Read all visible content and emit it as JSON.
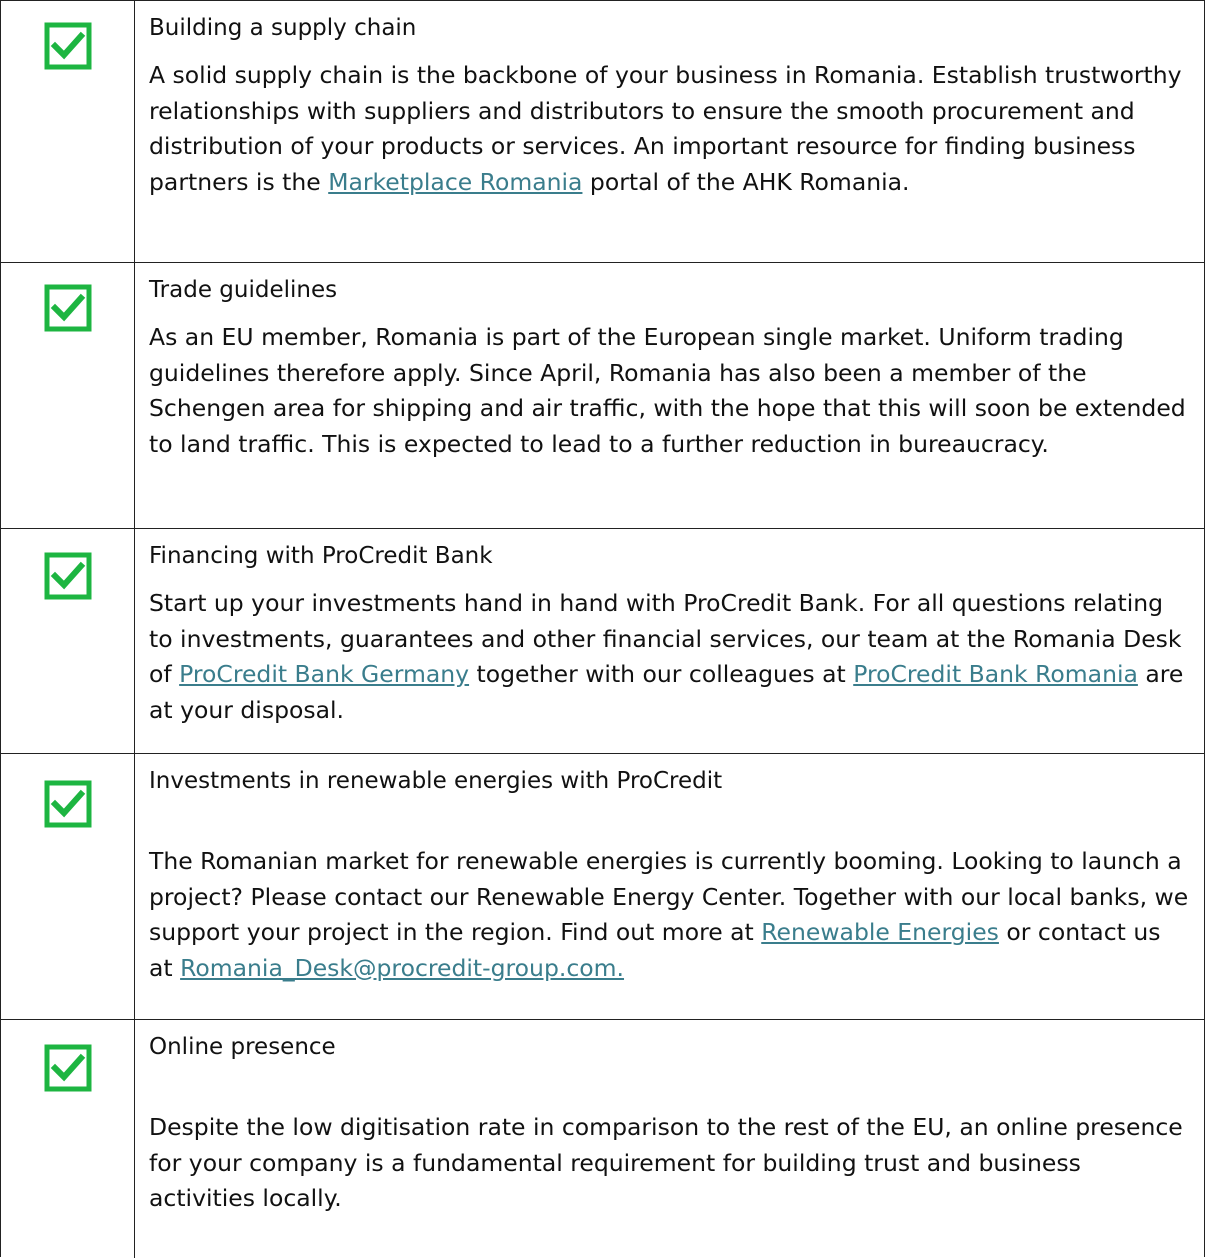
{
  "icon_color": "#1db541",
  "link_color": "#3a7d8c",
  "items": [
    {
      "icon": "checked-box-icon",
      "title": "Building a supply chain",
      "body_a": "A solid supply chain is the backbone of your business in Romania. Establish trustworthy relationships with suppliers and distributors to ensure the smooth procurement and distribution of your products or services. An important resource for finding business partners is the ",
      "link_1": "Marketplace Romania",
      "body_b": " portal of the AHK Romania."
    },
    {
      "icon": "checked-box-icon",
      "title": "Trade guidelines",
      "body_a": "As an EU member, Romania is part of the European single market. Uniform trading guidelines therefore apply. Since April, Romania has also been a member of the Schengen area for shipping and air traffic, with the hope that this will soon be extended to land traffic. This is expected to lead to a further reduction in bureaucracy."
    },
    {
      "icon": "checked-box-icon",
      "title": "Financing with ProCredit Bank",
      "body_a": "Start up your investments hand in hand with ProCredit Bank. For all questions relating to investments, guarantees and other financial services, our team at the Romania Desk of ",
      "link_1": "ProCredit Bank Germany",
      "body_b": " together with our colleagues at ",
      "link_2": "ProCredit Bank Romania",
      "body_c": " are at your disposal."
    },
    {
      "icon": "checked-box-icon",
      "title": "Investments in renewable energies with ProCredit",
      "body_a": "The Romanian market for renewable energies is currently booming. Looking to launch a project? Please contact our Renewable Energy Center. Together with our local banks, we support your project in the region. Find out more at ",
      "link_1": "Renewable Energies",
      "body_b": " or contact us at ",
      "link_2": "Romania_Desk@procredit-group.com.",
      "body_c": ""
    },
    {
      "icon": "checked-box-icon",
      "title": "Online presence",
      "body_a": "Despite the low digitisation rate in comparison to the rest of the EU, an online presence for your company is a fundamental requirement for building trust and business activities locally."
    }
  ]
}
